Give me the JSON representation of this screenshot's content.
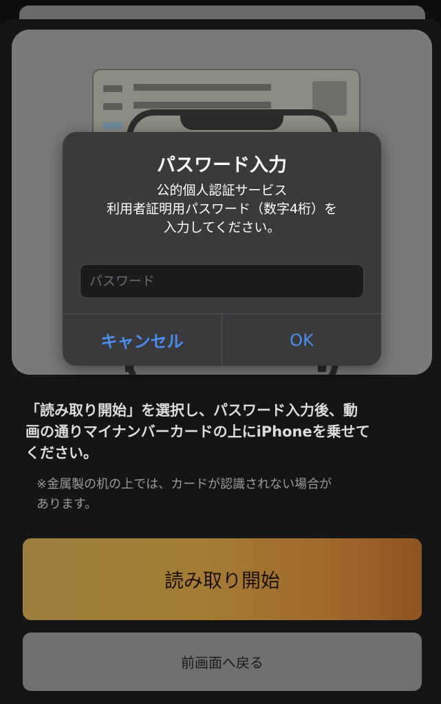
{
  "dialog": {
    "title": "パスワード入力",
    "message_lines": [
      "公的個人認証サービス",
      "利用者証明用パスワード（数字4桁）を",
      "入力してください。"
    ],
    "password_placeholder": "パスワード",
    "password_value": "",
    "cancel_label": "キャンセル",
    "ok_label": "OK",
    "button_color": "#4a8ef0"
  },
  "instructions": {
    "lines": [
      "「読み取り開始」を選択し、パスワード入力後、動",
      "画の通りマイナンバーカードの上にiPhoneを乗せて",
      "ください。"
    ]
  },
  "note": {
    "lines": [
      "※金属製の机の上では、カードが認識されない場合が",
      "あります。"
    ]
  },
  "buttons": {
    "start_reading": "読み取り開始",
    "back": "前画面へ戻る"
  },
  "illustration": {
    "card": "my-number-card",
    "device": "iphone"
  }
}
